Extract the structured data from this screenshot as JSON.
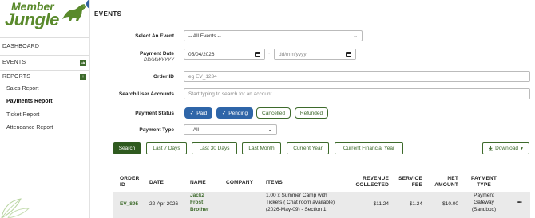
{
  "sidebar": {
    "logo_line1": "Member",
    "logo_line2": "Jungle",
    "notification_count": "6",
    "items": [
      {
        "label": "DASHBOARD"
      },
      {
        "label": "EVENTS",
        "toggle": "➜"
      },
      {
        "label": "REPORTS",
        "toggle": "+"
      },
      {
        "label": "Sales Report"
      },
      {
        "label": "Payments Report"
      },
      {
        "label": "Ticket Report"
      },
      {
        "label": "Attendance Report"
      }
    ]
  },
  "page": {
    "title": "EVENTS"
  },
  "filters": {
    "event": {
      "label": "Select An Event",
      "value": "-- All Events --"
    },
    "payment_date": {
      "label": "Payment Date",
      "format": "DD/MM/YYYY",
      "from": "05/04/2026",
      "separator": "-",
      "to": "dd/mm/yyyy"
    },
    "order_id": {
      "label": "Order ID",
      "placeholder": "eg EV_1234"
    },
    "user": {
      "label": "Search User Accounts",
      "placeholder": "Start typing to search for an account..."
    },
    "status": {
      "label": "Payment Status",
      "options": [
        "Paid",
        "Pending",
        "Cancelled",
        "Refunded"
      ],
      "check": "✓"
    },
    "type": {
      "label": "Payment Type",
      "value": "-- All --"
    }
  },
  "actions": {
    "search": "Search",
    "presets": [
      "Last 7 Days",
      "Last 30 Days",
      "Last Month",
      "Current Year",
      "Current Financial Year"
    ],
    "download": "Download"
  },
  "table": {
    "headers": {
      "order_id": [
        "ORDER",
        "ID"
      ],
      "date": "DATE",
      "name": "NAME",
      "company": "COMPANY",
      "items": "ITEMS",
      "revenue": [
        "REVENUE",
        "COLLECTED"
      ],
      "service_fee": [
        "SERVICE",
        "FEE"
      ],
      "net": [
        "NET",
        "AMOUNT"
      ],
      "payment_type": [
        "PAYMENT",
        "TYPE"
      ]
    },
    "rows": [
      {
        "order_id": "EV_895",
        "date": "22-Apr-2026",
        "name": [
          "Jack2",
          "Frost",
          "Brother"
        ],
        "company": "",
        "items": [
          "1.00 x Summer Camp with",
          "Tickets ( Chat room available)",
          "(2026-May-09) - Section 1"
        ],
        "revenue": "$11.24",
        "service_fee": "-$1.24",
        "net": "$10.00",
        "payment_type": [
          "Payment",
          "Gateway",
          "(Sandbox)"
        ],
        "menu": "•••"
      }
    ]
  }
}
